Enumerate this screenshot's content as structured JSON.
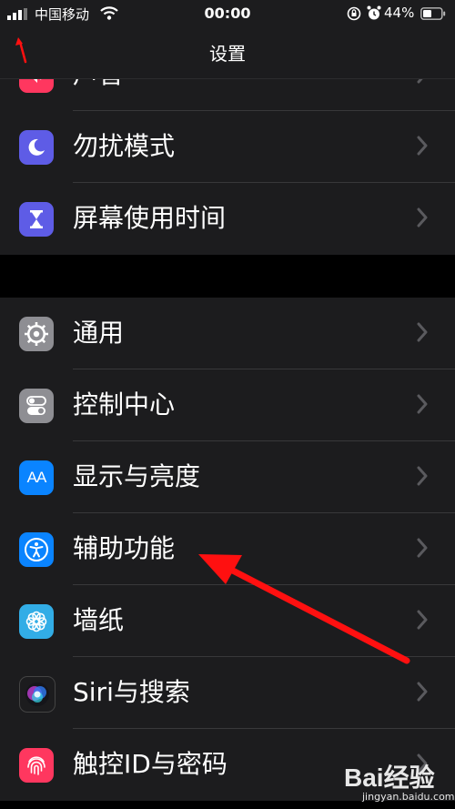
{
  "status_bar": {
    "carrier": "中国移动",
    "time": "00:00",
    "battery_percent": "44%"
  },
  "nav": {
    "title": "设置"
  },
  "group1": [
    {
      "label": "声音",
      "icon": "speaker-icon",
      "color": "#ff375f"
    },
    {
      "label": "勿扰模式",
      "icon": "moon-icon",
      "color": "#5e5ce6"
    },
    {
      "label": "屏幕使用时间",
      "icon": "hourglass-icon",
      "color": "#5e5ce6"
    }
  ],
  "group2": [
    {
      "label": "通用",
      "icon": "gear-icon",
      "color": "#8e8e93"
    },
    {
      "label": "控制中心",
      "icon": "toggles-icon",
      "color": "#8e8e93"
    },
    {
      "label": "显示与亮度",
      "icon": "text-size-icon",
      "icon_text": "AA",
      "color": "#0a84ff"
    },
    {
      "label": "辅助功能",
      "icon": "accessibility-icon",
      "color": "#0a84ff"
    },
    {
      "label": "墙纸",
      "icon": "flower-icon",
      "color": "#32ade6"
    },
    {
      "label": "Siri与搜索",
      "icon": "siri-icon",
      "color": "#1c1c1e"
    },
    {
      "label": "触控ID与密码",
      "icon": "fingerprint-icon",
      "color": "#ff375f"
    }
  ],
  "watermark": {
    "logo": "Bai经验",
    "site": "jingyan.baidu.com"
  }
}
